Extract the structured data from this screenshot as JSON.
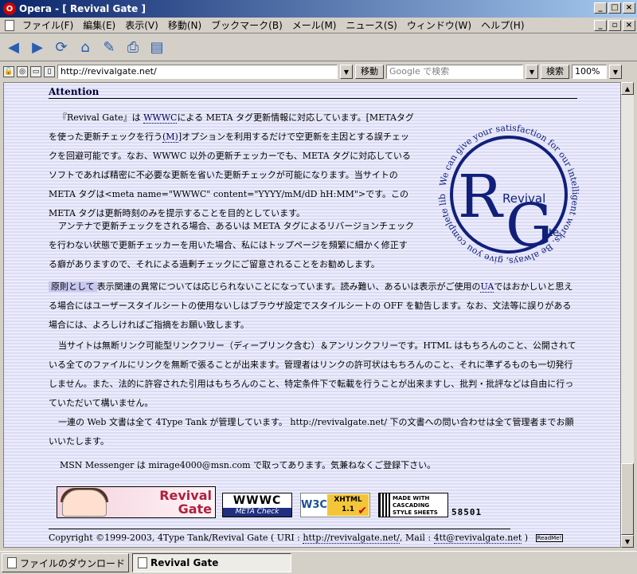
{
  "window": {
    "app_name": "Opera",
    "title": "Opera - [ Revival Gate ]"
  },
  "menu": {
    "items": [
      "ファイル(F)",
      "編集(E)",
      "表示(V)",
      "移動(N)",
      "ブックマーク(B)",
      "メール(M)",
      "ニュース(S)",
      "ウィンドウ(W)",
      "ヘルプ(H)"
    ]
  },
  "toolbar": {
    "buttons": [
      "back-icon",
      "forward-icon",
      "reload-icon",
      "home-icon",
      "hotlist-icon",
      "print-icon",
      "document-icon"
    ]
  },
  "address": {
    "url": "http://revivalgate.net/",
    "go_label": "移動",
    "search_placeholder": "Google で検索",
    "search_label": "検索",
    "zoom": "100%"
  },
  "page": {
    "heading": "Attention",
    "p1": {
      "a": "『Revival Gate』は",
      "wwwc": "WWWC",
      "b": "による META タグ更新情報に対応しています。[METAタグを使った更新チェックを行う",
      "m": "(M)",
      "c": "]オプションを利用するだけで空更新を主因とする誤チェックを回避可能です。なお、WWWC 以外の更新チェッカーでも、META タグに対応しているソフトであれば精密に不必要な更新を省いた更新チェックが可能になります。当サイトの META タグは<meta name=\"WWWC\" content=\"YYYY/mM/dD hH:MM\">です。この META タグは更新時刻のみを提示することを目的としています。"
    },
    "p2": "アンテナで更新チェックをされる場合、あるいは META タグによるリバージョンチェックを行わない状態で更新チェッカーを用いた場合、私にはトップページを頻繁に細かく修正する癖がありますので、それによる過剰チェックにご留意されることをお勧めします。",
    "p3": {
      "highlight": "原則として",
      "a": "表示関連の異常については応じられないことになっています。読み難い、あるいは表示がご使用の",
      "ua": "UA",
      "b": "ではおかしいと思える場合にはユーザースタイルシートの使用ないしはブラウザ設定でスタイルシートの OFF を勧告します。なお、文法等に誤りがある場合には、よろしければご指摘をお願い致します。"
    },
    "p4": "当サイトは無断リンク可能型リンクフリー（ディープリンク含む）＆アンリンクフリーです。HTML はもちろんのこと、公開されている全てのファイルにリンクを無断で張ることが出来ます。管理者はリンクの許可状はもちろんのこと、それに準ずるものも一切発行しません。また、法的に許容された引用はもちろんのこと、特定条件下で転載を行うことが出来ますし、批判・批評などは自由に行っていただいて構いません。",
    "p5": {
      "a": "一連の Web 文書は全て 4Type Tank が管理しています。",
      "url": "http://revivalgate.net/",
      "b": "下の文書への問い合わせは全て管理者までお願いいたします。"
    },
    "p6": {
      "a": "MSN Messenger は",
      "email": "mirage4000@msn.com",
      "b": "で取ってあります。気兼ねなくご登録下さい。"
    },
    "logo": {
      "letters_big_r": "R",
      "letters_big_g": "G",
      "word_revival": "Revival",
      "word_gate": "ate",
      "ring_text": "We can give your satisfaction for our intelligent works. Be always, give you complete liberalize."
    },
    "banners": {
      "revival_line1": "Revival",
      "revival_line2": "Gate",
      "wwwc_top": "WWWC",
      "wwwc_bottom": "META Check",
      "w3c_logo": "W3C",
      "w3c_xhtml": "XHTML",
      "w3c_version": "1.1",
      "css_text": "MADE WITH CASCADING STYLE SHEETS",
      "counter": "58501"
    },
    "footer": {
      "a": "Copyright ©1999-2003, 4Type Tank/Revival Gate ( URI :",
      "uri": "http://revivalgate.net/",
      "b": ", Mail :",
      "mail": "4tt@revivalgate.net",
      "c": ")",
      "badge": "ReadMe!"
    }
  },
  "tabs": [
    {
      "label": "ファイルのダウンロード"
    },
    {
      "label": "Revival Gate"
    }
  ],
  "colors": {
    "accent": "#0a246a",
    "logo_blue": "#10207a",
    "text_link": "#000066",
    "page_stripe_a": "#ececfc",
    "page_stripe_b": "#dcdcf4"
  }
}
